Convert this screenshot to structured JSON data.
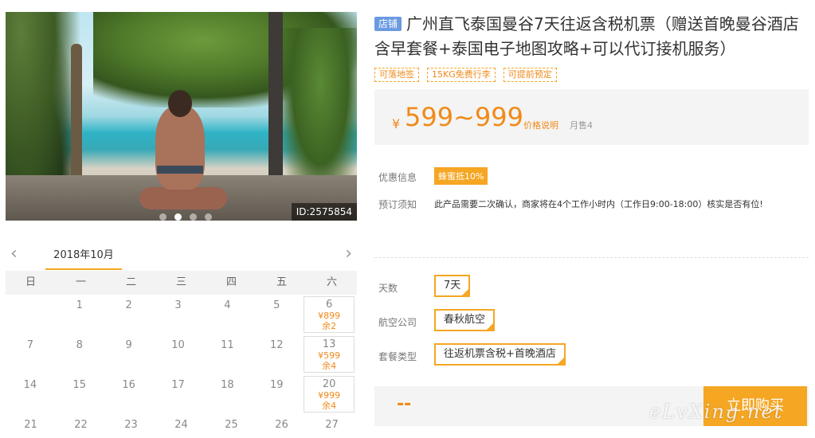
{
  "photo": {
    "id_label": "ID:2575854",
    "slide_count": 4,
    "active_slide": 2
  },
  "calendar": {
    "month": "2018年10月",
    "prev_icon": "chevron-left-icon",
    "next_icon": "chevron-right-icon",
    "weekdays": [
      "日",
      "一",
      "二",
      "三",
      "四",
      "五",
      "六"
    ],
    "rows": [
      [
        {
          "d": ""
        },
        {
          "d": "1"
        },
        {
          "d": "2"
        },
        {
          "d": "3"
        },
        {
          "d": "4"
        },
        {
          "d": "5"
        },
        {
          "d": "6",
          "price": "¥899",
          "left": "余2"
        }
      ],
      [
        {
          "d": "7"
        },
        {
          "d": "8"
        },
        {
          "d": "9"
        },
        {
          "d": "10"
        },
        {
          "d": "11"
        },
        {
          "d": "12"
        },
        {
          "d": "13",
          "price": "¥599",
          "left": "余4"
        }
      ],
      [
        {
          "d": "14"
        },
        {
          "d": "15"
        },
        {
          "d": "16"
        },
        {
          "d": "17"
        },
        {
          "d": "18"
        },
        {
          "d": "19"
        },
        {
          "d": "20",
          "price": "¥999",
          "left": "余4"
        }
      ],
      [
        {
          "d": "21"
        },
        {
          "d": "22"
        },
        {
          "d": "23"
        },
        {
          "d": "24"
        },
        {
          "d": "25"
        },
        {
          "d": "26"
        },
        {
          "d": "27"
        }
      ]
    ]
  },
  "product": {
    "store_tag": "店铺",
    "title": "广州直飞泰国曼谷7天往返含税机票（赠送首晚曼谷酒店含早套餐+泰国电子地图攻略+可以代订接机服务）",
    "tags": [
      "可落地签",
      "15KG免费行李",
      "可提前预定"
    ],
    "currency": "¥",
    "price_range": "599~999",
    "price_note": "价格说明",
    "monthly_sales": "月售4"
  },
  "info": {
    "promo_label": "优惠信息",
    "promo_value": "蜂蜜抵10%",
    "notice_label": "预订须知",
    "notice_value": "此产品需要二次确认，商家将在4个工作小时内（工作日9:00-18:00）核实是否有位!"
  },
  "options": {
    "days_label": "天数",
    "days_value": "7天",
    "airline_label": "航空公司",
    "airline_value": "春秋航空",
    "package_label": "套餐类型",
    "package_value": "往返机票含税+首晚酒店"
  },
  "buy": {
    "total": "--",
    "button": "立即购买"
  },
  "watermark": "eLvXing.net",
  "colors": {
    "accent": "#f5a623",
    "price": "#f08a1a",
    "store_tag": "#6a9ae0"
  }
}
